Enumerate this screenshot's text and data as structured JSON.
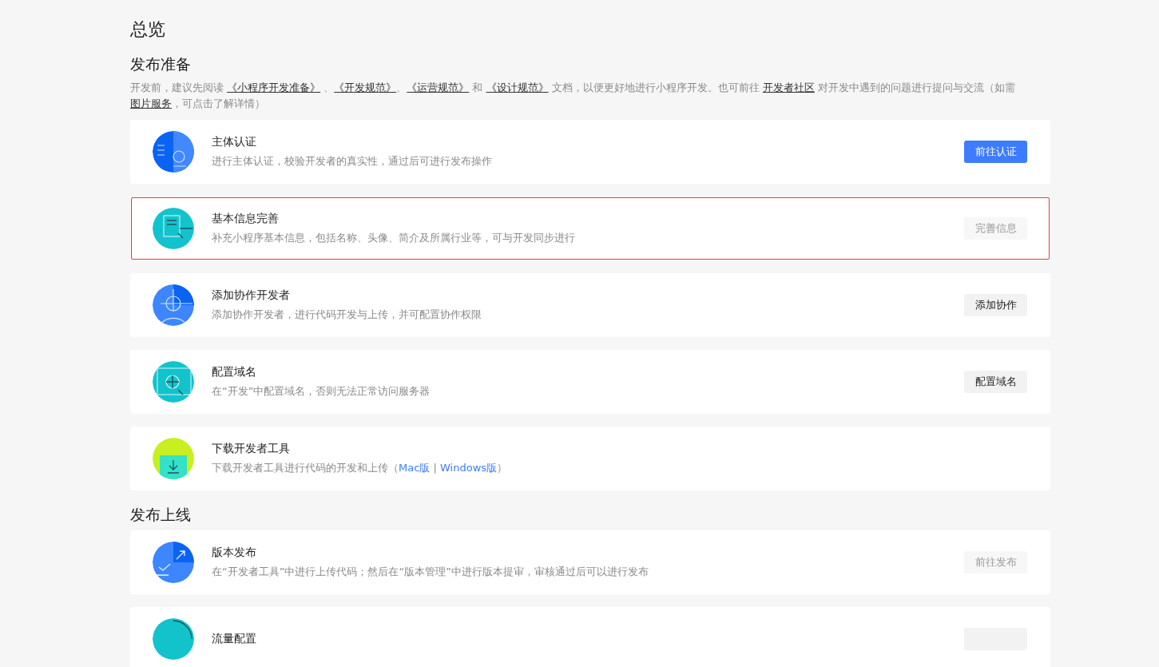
{
  "page_title": "总览",
  "sections": [
    {
      "title": "发布准备",
      "intro": [
        {
          "kind": "text",
          "text": "开发前，建议先阅读 "
        },
        {
          "kind": "link",
          "text": "《小程序开发准备》"
        },
        {
          "kind": "text",
          "text": " 、"
        },
        {
          "kind": "link",
          "text": "《开发规范》"
        },
        {
          "kind": "text",
          "text": "、"
        },
        {
          "kind": "link",
          "text": "《运营规范》"
        },
        {
          "kind": "text",
          "text": " 和 "
        },
        {
          "kind": "link",
          "text": "《设计规范》"
        },
        {
          "kind": "text",
          "text": " 文档，以便更好地进行小程序开发。也可前往 "
        },
        {
          "kind": "link",
          "text": "开发者社区"
        },
        {
          "kind": "text",
          "text": " 对开发中遇到的问题进行提问与交流（如需"
        },
        {
          "kind": "link",
          "text": "图片服务"
        },
        {
          "kind": "text",
          "text": "，可点击了解详情）"
        }
      ],
      "cards": [
        {
          "title": "主体认证",
          "highlighted": false,
          "description": [
            {
              "kind": "text",
              "text": "进行主体认证，校验开发者的真实性，通过后可进行发布操作"
            }
          ],
          "button": {
            "label": "前往认证",
            "kind": "primary",
            "disabled": false
          }
        },
        {
          "title": "基本信息完善",
          "highlighted": true,
          "description": [
            {
              "kind": "text",
              "text": "补充小程序基本信息，包括名称、头像、简介及所属行业等，可与开发同步进行"
            }
          ],
          "button": {
            "label": "完善信息",
            "kind": "default",
            "disabled": true
          }
        },
        {
          "title": "添加协作开发者",
          "highlighted": false,
          "description": [
            {
              "kind": "text",
              "text": "添加协作开发者，进行代码开发与上传，并可配置协作权限"
            }
          ],
          "button": {
            "label": "添加协作",
            "kind": "default",
            "disabled": false
          }
        },
        {
          "title": "配置域名",
          "highlighted": false,
          "description": [
            {
              "kind": "text",
              "text": "在“开发”中配置域名，否则无法正常访问服务器"
            }
          ],
          "button": {
            "label": "配置域名",
            "kind": "default",
            "disabled": false
          }
        },
        {
          "title": "下载开发者工具",
          "highlighted": false,
          "description": [
            {
              "kind": "text",
              "text": "下载开发者工具进行代码的开发和上传（"
            },
            {
              "kind": "link",
              "text": "Mac版"
            },
            {
              "kind": "text",
              "text": " | "
            },
            {
              "kind": "link",
              "text": "Windows版"
            },
            {
              "kind": "text",
              "text": "）"
            }
          ]
        }
      ]
    },
    {
      "title": "发布上线",
      "cards": [
        {
          "title": "版本发布",
          "highlighted": false,
          "description": [
            {
              "kind": "text",
              "text": "在“开发者工具”中进行上传代码；然后在“版本管理”中进行版本提审，审核通过后可以进行发布"
            }
          ],
          "button": {
            "label": "前往发布",
            "kind": "default",
            "disabled": true
          }
        },
        {
          "title": "流量配置",
          "highlighted": false,
          "button": {
            "kind": "default"
          }
        }
      ]
    }
  ]
}
